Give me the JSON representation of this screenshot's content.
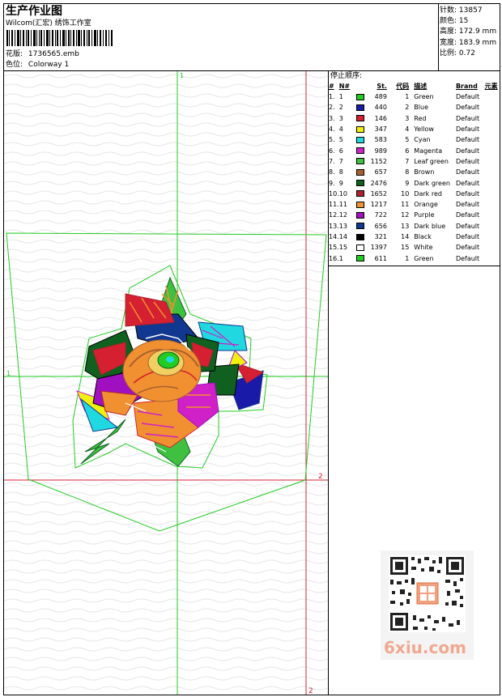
{
  "header": {
    "title": "生产作业图",
    "company": "Wilcom(汇宏) 绣饰工作室",
    "design_label": "花版:",
    "design_file": "1736565.emb",
    "colorway_label": "色位:",
    "colorway": "Colorway 1"
  },
  "stats": {
    "stitches_label": "针数:",
    "stitches": "13857",
    "colors_label": "颜色:",
    "colors": "15",
    "height_label": "高度:",
    "height": "172.9 mm",
    "width_label": "宽度:",
    "width": "183.9 mm",
    "ratio_label": "比例:",
    "ratio": "0.72"
  },
  "stop_sequence": {
    "title": "停止顺序:",
    "headers": [
      "#",
      "N#",
      "St.",
      "代码",
      "描述",
      "Brand",
      "元素"
    ],
    "rows": [
      {
        "idx": "1.",
        "n": "1",
        "color": "#22cc22",
        "st": "489",
        "code": "1",
        "desc": "Green",
        "brand": "Default"
      },
      {
        "idx": "2.",
        "n": "2",
        "color": "#1a1aa8",
        "st": "440",
        "code": "2",
        "desc": "Blue",
        "brand": "Default"
      },
      {
        "idx": "3.",
        "n": "3",
        "color": "#d42030",
        "st": "146",
        "code": "3",
        "desc": "Red",
        "brand": "Default"
      },
      {
        "idx": "4.",
        "n": "4",
        "color": "#f0f010",
        "st": "347",
        "code": "4",
        "desc": "Yellow",
        "brand": "Default"
      },
      {
        "idx": "5.",
        "n": "5",
        "color": "#20d8e0",
        "st": "583",
        "code": "5",
        "desc": "Cyan",
        "brand": "Default"
      },
      {
        "idx": "6.",
        "n": "6",
        "color": "#d020c8",
        "st": "989",
        "code": "6",
        "desc": "Magenta",
        "brand": "Default"
      },
      {
        "idx": "7.",
        "n": "7",
        "color": "#40c040",
        "st": "1152",
        "code": "7",
        "desc": "Leaf green",
        "brand": "Default"
      },
      {
        "idx": "8.",
        "n": "8",
        "color": "#a86030",
        "st": "657",
        "code": "8",
        "desc": "Brown",
        "brand": "Default"
      },
      {
        "idx": "9.",
        "n": "9",
        "color": "#106020",
        "st": "2476",
        "code": "9",
        "desc": "Dark green",
        "brand": "Default"
      },
      {
        "idx": "10.",
        "n": "10",
        "color": "#b02030",
        "st": "1652",
        "code": "10",
        "desc": "Dark red",
        "brand": "Default"
      },
      {
        "idx": "11.",
        "n": "11",
        "color": "#f09030",
        "st": "1217",
        "code": "11",
        "desc": "Orange",
        "brand": "Default"
      },
      {
        "idx": "12.",
        "n": "12",
        "color": "#a010c0",
        "st": "722",
        "code": "12",
        "desc": "Purple",
        "brand": "Default"
      },
      {
        "idx": "13.",
        "n": "13",
        "color": "#103890",
        "st": "656",
        "code": "13",
        "desc": "Dark blue",
        "brand": "Default"
      },
      {
        "idx": "14.",
        "n": "14",
        "color": "#000000",
        "st": "321",
        "code": "14",
        "desc": "Black",
        "brand": "Default"
      },
      {
        "idx": "15.",
        "n": "15",
        "color": "#ffffff",
        "st": "1397",
        "code": "15",
        "desc": "White",
        "brand": "Default"
      },
      {
        "idx": "16.",
        "n": "1",
        "color": "#22cc22",
        "st": "611",
        "code": "1",
        "desc": "Green",
        "brand": "Default"
      }
    ]
  },
  "canvas": {
    "marker_top_left": "1",
    "marker_left": "1",
    "marker_right": "2",
    "marker_bottom": "2"
  },
  "watermark": {
    "text": "6xiu.com"
  }
}
